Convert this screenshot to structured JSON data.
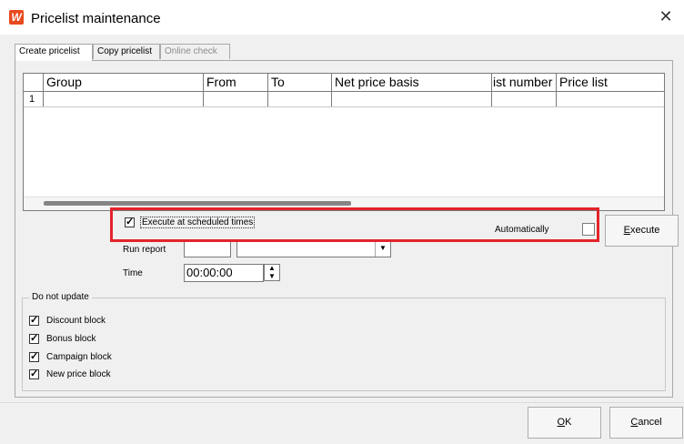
{
  "window": {
    "title": "Pricelist maintenance",
    "app_icon_letter": "W",
    "close_glyph": "✕"
  },
  "tabs": [
    {
      "label": "Create pricelist",
      "active": true
    },
    {
      "label": "Copy pricelist",
      "active": false
    },
    {
      "label": "Online check",
      "active": false,
      "disabled": true
    }
  ],
  "grid": {
    "columns": [
      "Group",
      "From",
      "To",
      "Net price basis",
      "ist number",
      "Price list"
    ],
    "rows": [
      {
        "index": "1",
        "cells": [
          "",
          "",
          "",
          "",
          "",
          ""
        ]
      }
    ]
  },
  "schedule": {
    "execute_scheduled_label": "Execute at scheduled times",
    "execute_scheduled_checked": true,
    "automatically_label": "Automatically",
    "automatically_checked": false,
    "execute_button_label_ul": "E",
    "execute_button_label_rest": "xecute",
    "run_report_label": "Run report",
    "run_report_value": "",
    "run_report_select": "",
    "time_label": "Time",
    "time_value": "00:00:00"
  },
  "do_not_update": {
    "title": "Do not update",
    "items": [
      {
        "label": "Discount block",
        "checked": true
      },
      {
        "label": "Bonus block",
        "checked": true
      },
      {
        "label": "Campaign block",
        "checked": true
      },
      {
        "label": "New price block",
        "checked": true
      }
    ]
  },
  "footer": {
    "ok_ul": "O",
    "ok_rest": "K",
    "cancel_ul": "C",
    "cancel_rest": "ancel"
  },
  "colors": {
    "highlight": "#e3242b",
    "app_icon": "#e8491d"
  },
  "glyphs": {
    "check": "✓",
    "dropdown": "▼",
    "spin_up": "▲",
    "spin_down": "▼"
  }
}
